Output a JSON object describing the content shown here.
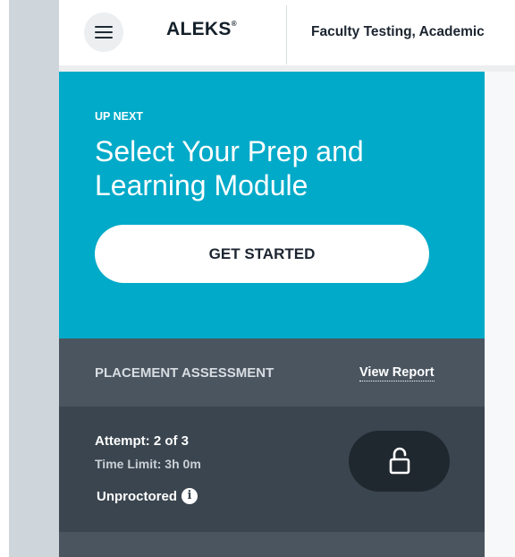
{
  "header": {
    "menu_icon": "hamburger-menu-icon",
    "logo_text": "ALEKS",
    "logo_mark": "®",
    "course_title": "Faculty Testing, Academic"
  },
  "up_next": {
    "label": "UP NEXT",
    "title": "Select Your Prep and Learning Module",
    "button_label": "GET STARTED",
    "background_color": "#00aac8"
  },
  "placement": {
    "label": "PLACEMENT ASSESSMENT",
    "view_report_label": "View Report",
    "attempt": "Attempt: 2 of 3",
    "time_limit": "Time Limit: 3h 0m",
    "proctoring": "Unproctored",
    "info_icon": "info-icon",
    "lock_icon": "unlocked-padlock-icon"
  }
}
